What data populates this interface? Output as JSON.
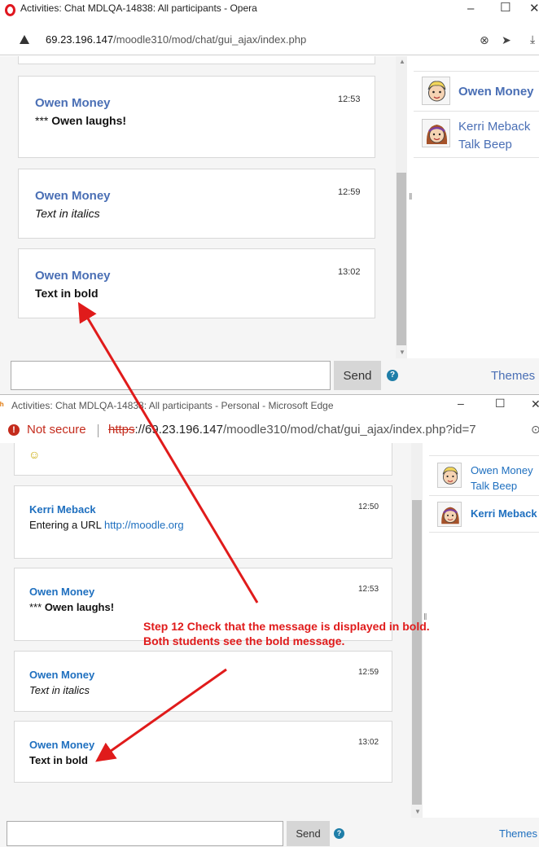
{
  "window1": {
    "title": "Activities: Chat MDLQA-14838: All participants - Opera",
    "controls": {
      "minimize": "–",
      "maximize": "☐",
      "close": "✕"
    },
    "url_host": "69.23.196.147",
    "url_path": "/moodle310/mod/chat/gui_ajax/index.php",
    "messages": [
      {
        "user": "Owen Money",
        "time": "12:53",
        "prefix": "***",
        "text": "Owen laughs!",
        "style": "action"
      },
      {
        "user": "Owen Money",
        "time": "12:59",
        "text": "Text in italics",
        "style": "italic"
      },
      {
        "user": "Owen Money",
        "time": "13:02",
        "text": "Text in bold",
        "style": "bold"
      }
    ],
    "users": [
      {
        "name": "Owen Money",
        "bold": true
      },
      {
        "name": "Kerri Meback",
        "beep": "Talk Beep"
      }
    ],
    "send_label": "Send",
    "themes_label": "Themes »"
  },
  "window2": {
    "title": "Activities: Chat MDLQA-14838: All participants - Personal - Microsoft Edge",
    "controls": {
      "minimize": "–",
      "maximize": "☐",
      "close": "✕"
    },
    "not_secure": "Not secure",
    "url_scheme": "https",
    "url_host": "://69.23.196.147",
    "url_path": "/moodle310/mod/chat/gui_ajax/index.php?id=7",
    "smiley": "☺",
    "messages": [
      {
        "user": "Kerri Meback",
        "time": "12:50",
        "text": "Entering a URL",
        "link": "http://moodle.org"
      },
      {
        "user": "Owen Money",
        "time": "12:53",
        "prefix": "***",
        "text": "Owen laughs!"
      },
      {
        "user": "Owen Money",
        "time": "12:59",
        "text": "Text in italics"
      },
      {
        "user": "Owen Money",
        "time": "13:02",
        "text": "Text in bold"
      }
    ],
    "users": [
      {
        "name": "Owen Money",
        "beep": "Talk Beep"
      },
      {
        "name": "Kerri Meback",
        "bold": true
      }
    ],
    "send_label": "Send",
    "themes_label": "Themes"
  },
  "annotation": {
    "line1": "Step 12 Check that the message is displayed in bold.",
    "line2": "Both students see the bold message.",
    "color": "#e01b1b"
  }
}
